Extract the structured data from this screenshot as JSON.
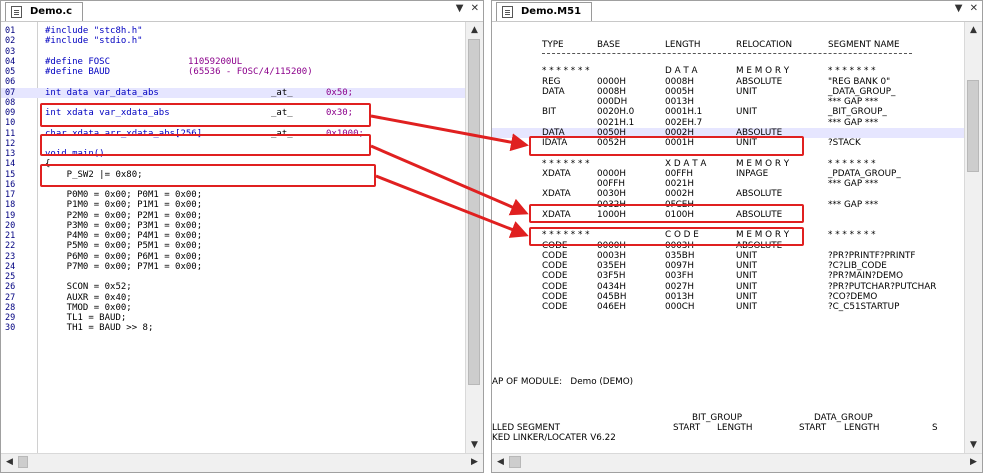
{
  "left_pane": {
    "tab_title": "Demo.c",
    "controls": [
      "▼",
      "✕"
    ],
    "lines": [
      {
        "n": "01",
        "t": "#include \"stc8h.h\""
      },
      {
        "n": "02",
        "t": "#include \"stdio.h\""
      },
      {
        "n": "03",
        "t": ""
      },
      {
        "n": "04",
        "t": "#define FOSC",
        "t2": "11059200UL"
      },
      {
        "n": "05",
        "t": "#define BAUD",
        "t2": "(65536 - FOSC/4/115200)"
      },
      {
        "n": "06",
        "t": ""
      },
      {
        "n": "07",
        "t": "int data var_data_abs",
        "t2": "_at_",
        "t3": "0x50;"
      },
      {
        "n": "08",
        "t": ""
      },
      {
        "n": "09",
        "t": "int xdata var_xdata_abs",
        "t2": "_at_",
        "t3": "0x30;"
      },
      {
        "n": "10",
        "t": ""
      },
      {
        "n": "11",
        "t": "char xdata arr_xdata_abs[256]",
        "t2": "_at_",
        "t3": "0x1000;"
      },
      {
        "n": "12",
        "t": ""
      },
      {
        "n": "13",
        "t": "void main()"
      },
      {
        "n": "14",
        "t": "{"
      },
      {
        "n": "15",
        "t": "    P_SW2 |= 0x80;"
      },
      {
        "n": "16",
        "t": ""
      },
      {
        "n": "17",
        "t": "    P0M0 = 0x00; P0M1 = 0x00;"
      },
      {
        "n": "18",
        "t": "    P1M0 = 0x00; P1M1 = 0x00;"
      },
      {
        "n": "19",
        "t": "    P2M0 = 0x00; P2M1 = 0x00;"
      },
      {
        "n": "20",
        "t": "    P3M0 = 0x00; P3M1 = 0x00;"
      },
      {
        "n": "21",
        "t": "    P4M0 = 0x00; P4M1 = 0x00;"
      },
      {
        "n": "22",
        "t": "    P5M0 = 0x00; P5M1 = 0x00;"
      },
      {
        "n": "23",
        "t": "    P6M0 = 0x00; P6M1 = 0x00;"
      },
      {
        "n": "24",
        "t": "    P7M0 = 0x00; P7M1 = 0x00;"
      },
      {
        "n": "25",
        "t": ""
      },
      {
        "n": "26",
        "t": "    SCON = 0x52;"
      },
      {
        "n": "27",
        "t": "    AUXR = 0x40;"
      },
      {
        "n": "28",
        "t": "    TMOD = 0x00;"
      },
      {
        "n": "29",
        "t": "    TL1 = BAUD;"
      },
      {
        "n": "30",
        "t": "    TH1 = BAUD >> 8;"
      }
    ]
  },
  "right_pane": {
    "tab_title": "Demo.M51",
    "controls": [
      "▼",
      "✕"
    ],
    "header": {
      "type": "TYPE",
      "base": "BASE",
      "length": "LENGTH",
      "relocation": "RELOCATION",
      "segment_name": "SEGMENT NAME"
    },
    "rows": [
      {
        "a": "",
        "b": "",
        "c": "",
        "d": "",
        "e": ""
      },
      {
        "a": "* * * * * * *",
        "b": "",
        "c": "D A T A",
        "d": "M E M O R Y",
        "e": "* * * * * * *"
      },
      {
        "a": "REG",
        "b": "0000H",
        "c": "0008H",
        "d": "ABSOLUTE",
        "e": "\"REG BANK 0\""
      },
      {
        "a": "DATA",
        "b": "0008H",
        "c": "0005H",
        "d": "UNIT",
        "e": "_DATA_GROUP_"
      },
      {
        "a": "",
        "b": "000DH",
        "c": "0013H",
        "d": "",
        "e": "*** GAP ***"
      },
      {
        "a": "BIT",
        "b": "0020H.0",
        "c": "0001H.1",
        "d": "UNIT",
        "e": "_BIT_GROUP_"
      },
      {
        "a": "",
        "b": "0021H.1",
        "c": "002EH.7",
        "d": "",
        "e": "*** GAP ***"
      },
      {
        "a": "DATA",
        "b": "0050H",
        "c": "0002H",
        "d": "ABSOLUTE",
        "e": ""
      },
      {
        "a": "IDATA",
        "b": "0052H",
        "c": "0001H",
        "d": "UNIT",
        "e": "?STACK"
      },
      {
        "a": "",
        "b": "",
        "c": "",
        "d": "",
        "e": ""
      },
      {
        "a": "* * * * * * *",
        "b": "",
        "c": "X D A T A",
        "d": "M E M O R Y",
        "e": "* * * * * * *"
      },
      {
        "a": "XDATA",
        "b": "0000H",
        "c": "00FFH",
        "d": "INPAGE",
        "e": "_PDATA_GROUP_"
      },
      {
        "a": "",
        "b": "00FFH",
        "c": "0021H",
        "d": "",
        "e": "*** GAP ***"
      },
      {
        "a": "XDATA",
        "b": "0030H",
        "c": "0002H",
        "d": "ABSOLUTE",
        "e": ""
      },
      {
        "a": "",
        "b": "0032H",
        "c": "0FCEH",
        "d": "",
        "e": "*** GAP ***"
      },
      {
        "a": "XDATA",
        "b": "1000H",
        "c": "0100H",
        "d": "ABSOLUTE",
        "e": ""
      },
      {
        "a": "",
        "b": "",
        "c": "",
        "d": "",
        "e": ""
      },
      {
        "a": "* * * * * * *",
        "b": "",
        "c": "C O D E",
        "d": "M E M O R Y",
        "e": "* * * * * * *"
      },
      {
        "a": "CODE",
        "b": "0000H",
        "c": "0003H",
        "d": "ABSOLUTE",
        "e": ""
      },
      {
        "a": "CODE",
        "b": "0003H",
        "c": "035BH",
        "d": "UNIT",
        "e": "?PR?PRINTF?PRINTF"
      },
      {
        "a": "CODE",
        "b": "035EH",
        "c": "0097H",
        "d": "UNIT",
        "e": "?C?LIB_CODE"
      },
      {
        "a": "CODE",
        "b": "03F5H",
        "c": "003FH",
        "d": "UNIT",
        "e": "?PR?MAIN?DEMO"
      },
      {
        "a": "CODE",
        "b": "0434H",
        "c": "0027H",
        "d": "UNIT",
        "e": "?PR?PUTCHAR?PUTCHAR"
      },
      {
        "a": "CODE",
        "b": "045BH",
        "c": "0013H",
        "d": "UNIT",
        "e": "?CO?DEMO"
      },
      {
        "a": "CODE",
        "b": "046EH",
        "c": "000CH",
        "d": "UNIT",
        "e": "?C_C51STARTUP"
      }
    ],
    "map_line": "AP OF MODULE:   Demo (DEMO)",
    "bottom": {
      "bit_group": "BIT_GROUP",
      "data_group": "DATA_GROUP",
      "seg_label": "LLED SEGMENT",
      "start1": "START",
      "length1": "LENGTH",
      "start2": "START",
      "length2": "LENGTH",
      "tail": "S",
      "linker": "KED LINKER/LOCATER V6.22"
    }
  },
  "colors": {
    "highlight_box": "#e02020",
    "arrow": "#e02020",
    "keyword": "#0000c0",
    "current_line": "#e6e6ff"
  }
}
